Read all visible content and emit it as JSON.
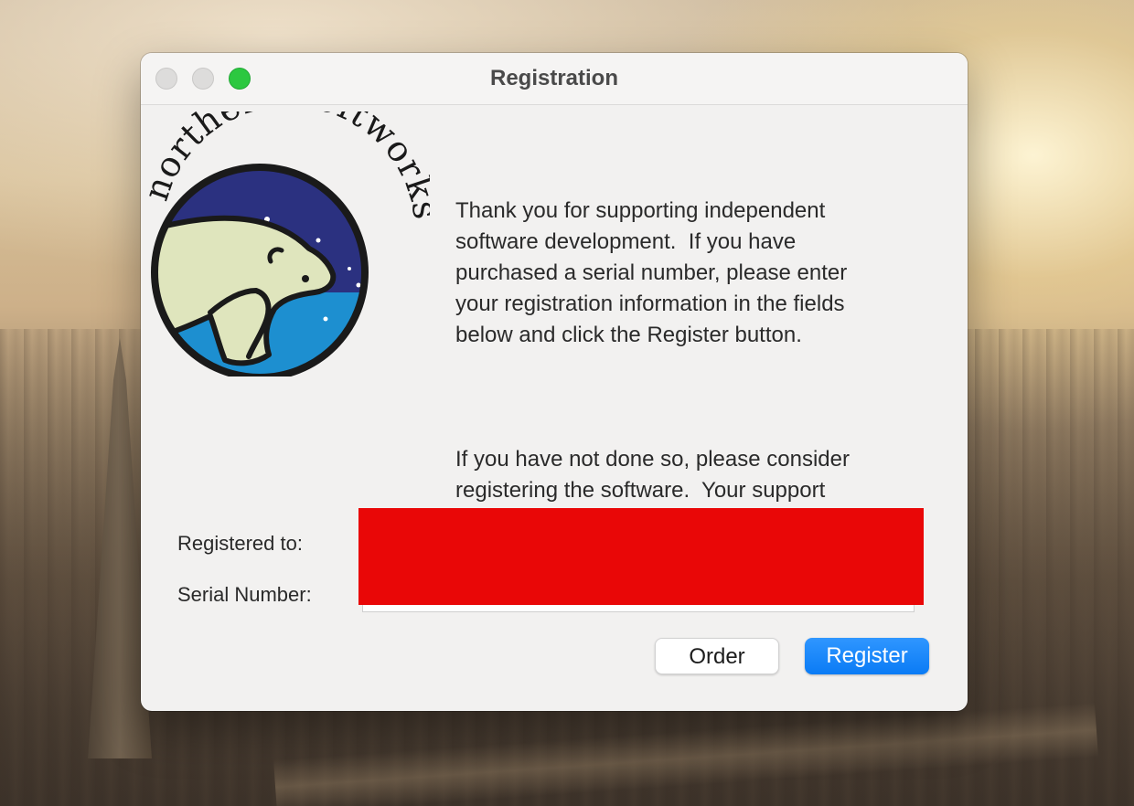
{
  "window": {
    "title": "Registration",
    "controls": [
      "close-button",
      "minimize-button",
      "zoom-button"
    ]
  },
  "logo": {
    "brand_text": "northern softworks",
    "icon": "polar-bear-logo-icon",
    "colors": {
      "night_sky": "#2b3180",
      "water": "#1d8fd0",
      "bear": "#dfe5bd",
      "outline": "#1a1a1a"
    }
  },
  "intro": {
    "paragraph_1": "Thank you for supporting independent\nsoftware development.  If you have\npurchased a serial number, please enter\nyour registration information in the fields\nbelow and click the Register button.",
    "paragraph_2": "If you have not done so, please consider\nregistering the software.  Your support\nhelps ensure continued development.  You\nmay safely order online by clicking the\nOrder button."
  },
  "form": {
    "registered_to_label": "Registered to:",
    "registered_to_value": "",
    "serial_number_label": "Serial Number:",
    "serial_number_value": "",
    "redaction_color": "#e90707"
  },
  "buttons": {
    "order_label": "Order",
    "register_label": "Register",
    "accent_color": "#0a7bf5"
  }
}
